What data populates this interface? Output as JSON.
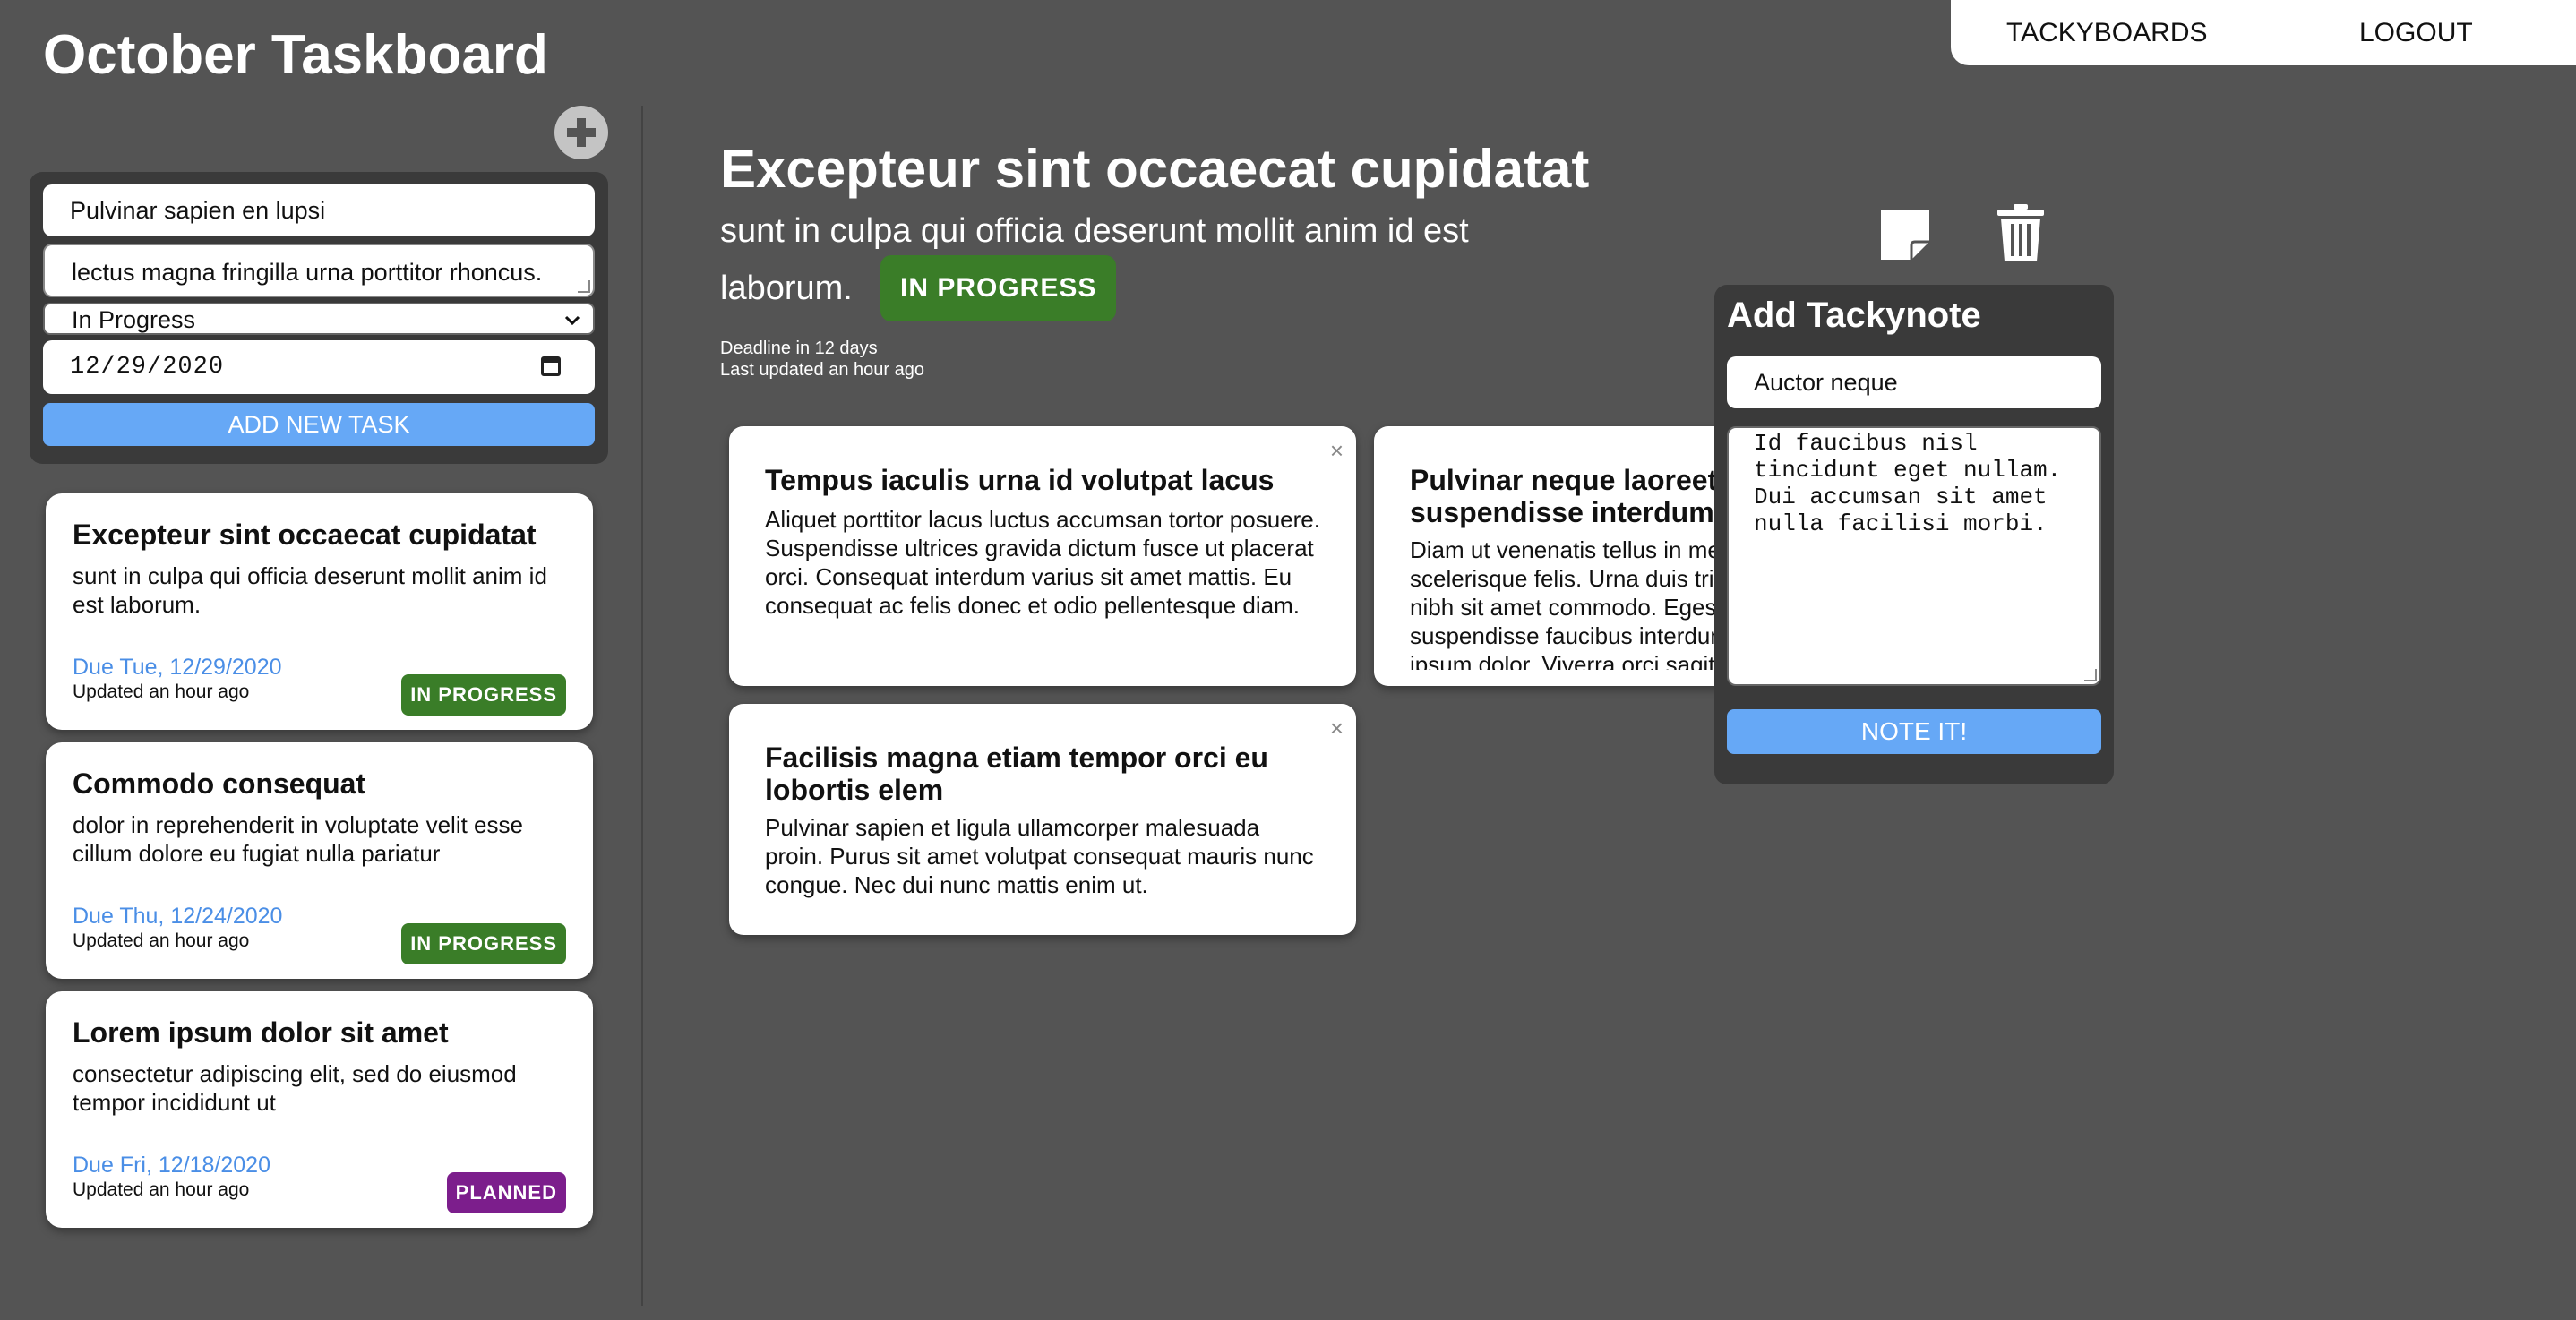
{
  "board": {
    "title": "October Taskboard"
  },
  "nav": {
    "tackyboards": "TACKYBOARDS",
    "logout": "LOGOUT"
  },
  "icons": {
    "add": "plus-circle-icon",
    "note": "sticky-note-icon",
    "trash": "trash-icon",
    "close": "close-icon",
    "calendar": "calendar-icon",
    "dropdown": "chevron-down-icon"
  },
  "form": {
    "title_value": "Pulvinar sapien en lupsi",
    "description_value": "lectus magna fringilla urna porttitor rhoncus.",
    "status_value": "In Progress",
    "date_value": "12/29/2020",
    "submit_label": "ADD NEW TASK"
  },
  "tasks": [
    {
      "title": "Excepteur sint occaecat cupidatat",
      "description": "sunt in culpa qui officia deserunt mollit anim id est laborum.",
      "due": "Due Tue, 12/29/2020",
      "updated": "Updated an hour ago",
      "status": "IN PROGRESS"
    },
    {
      "title": "Commodo consequat",
      "description": "dolor in reprehenderit in voluptate velit esse cillum dolore eu fugiat nulla pariatur",
      "due": "Due Thu, 12/24/2020",
      "updated": "Updated an hour ago",
      "status": "IN PROGRESS"
    },
    {
      "title": "Lorem ipsum dolor sit amet",
      "description": "consectetur adipiscing elit, sed do eiusmod tempor incididunt ut",
      "due": "Due Fri, 12/18/2020",
      "updated": "Updated an hour ago",
      "status": "PLANNED"
    }
  ],
  "detail": {
    "title": "Excepteur sint occaecat cupidatat",
    "description": "sunt in culpa qui officia deserunt mollit anim id est laborum.",
    "status": "IN PROGRESS",
    "deadline": "Deadline in 12 days",
    "last_updated": "Last updated an hour ago"
  },
  "notes": [
    {
      "title": "Tempus iaculis urna id volutpat lacus",
      "body": "Aliquet porttitor lacus luctus accumsan tortor posuere. Suspendisse ultrices gravida dictum fusce ut placerat orci. Consequat interdum varius sit amet mattis. Eu consequat ac felis donec et odio pellentesque diam.",
      "close": "×"
    },
    {
      "title": "Pulvinar neque laoreet suspendisse interdum consec",
      "body": "Diam ut venenatis tellus in metus vulputate eu scelerisque felis. Urna duis tristique sollicitudin nibh sit amet commodo. Egestas congue lacus suspendisse faucibus interdum posuere lorem ipsum dolor. Viverra orci sagittis eu volutpat odio facilisis mauris.",
      "close": "×"
    },
    {
      "title": "Facilisis magna etiam tempor orci eu lobortis elem",
      "body": "Pulvinar sapien et ligula ullamcorper malesuada proin. Purus sit amet volutpat consequat mauris nunc congue. Nec dui nunc mattis enim ut.",
      "close": "×"
    }
  ],
  "add_note": {
    "heading": "Add Tackynote",
    "title_value": "Auctor neque",
    "body_value": "Id faucibus nisl\ntincidunt eget nullam.\nDui accumsan sit amet\nnulla facilisi morbi.",
    "submit_label": "NOTE IT!"
  },
  "colors": {
    "background": "#545454",
    "panel": "#3a3a3a",
    "accent_blue": "#66a8f6",
    "in_progress": "#3a7d28",
    "planned": "#7c1e8c",
    "due_text": "#4a8ee6"
  }
}
